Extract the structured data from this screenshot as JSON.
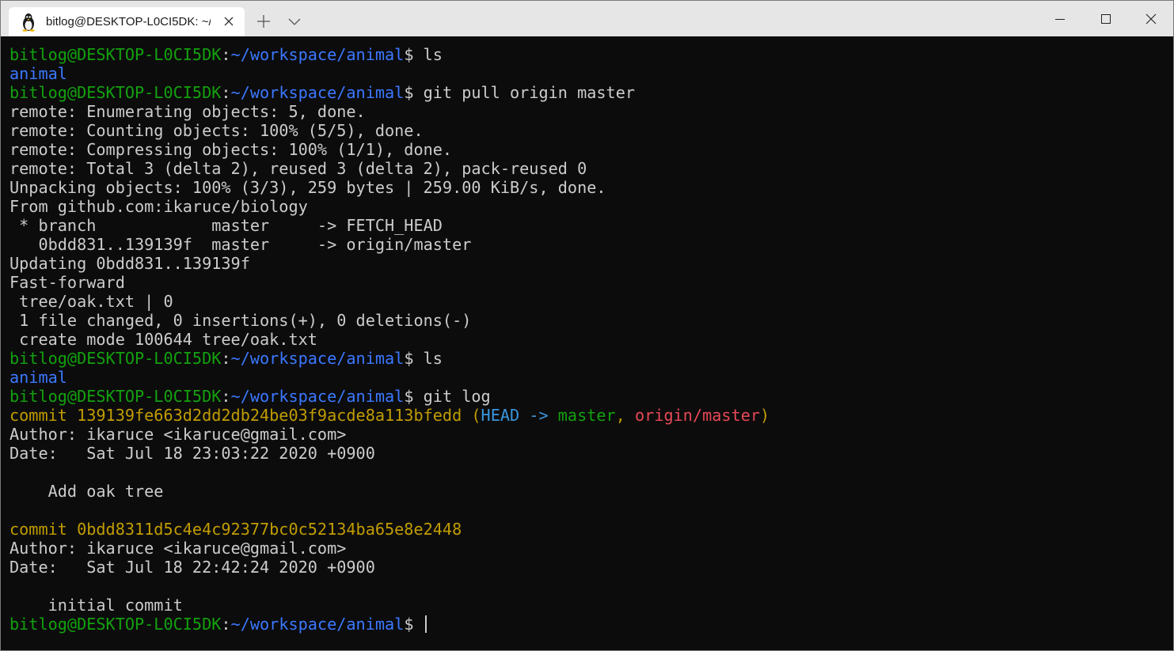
{
  "tab": {
    "title": "bitlog@DESKTOP-L0CI5DK: ~/workspace/animal",
    "icon": "linux-penguin-icon"
  },
  "prompt": {
    "user_host": "bitlog@DESKTOP-L0CI5DK",
    "sep": ":",
    "path": "~/workspace/animal",
    "dollar": "$"
  },
  "colors": {
    "background": "#0c0c0c",
    "green": "#13a10e",
    "blue": "#3b78ff",
    "yellow": "#c19c00",
    "cyan": "#3a96dd",
    "red": "#e74856",
    "text": "#cccccc"
  },
  "lines": [
    {
      "cmd": " ls"
    },
    {
      "dir": "animal"
    },
    {
      "cmd": " git pull origin master"
    },
    {
      "text": "remote: Enumerating objects: 5, done."
    },
    {
      "text": "remote: Counting objects: 100% (5/5), done."
    },
    {
      "text": "remote: Compressing objects: 100% (1/1), done."
    },
    {
      "text": "remote: Total 3 (delta 2), reused 3 (delta 2), pack-reused 0"
    },
    {
      "text": "Unpacking objects: 100% (3/3), 259 bytes | 259.00 KiB/s, done."
    },
    {
      "text": "From github.com:ikaruce/biology"
    },
    {
      "text": " * branch            master     -> FETCH_HEAD"
    },
    {
      "text": "   0bdd831..139139f  master     -> origin/master"
    },
    {
      "text": "Updating 0bdd831..139139f"
    },
    {
      "text": "Fast-forward"
    },
    {
      "text": " tree/oak.txt | 0"
    },
    {
      "text": " 1 file changed, 0 insertions(+), 0 deletions(-)"
    },
    {
      "text": " create mode 100644 tree/oak.txt"
    },
    {
      "cmd": " ls"
    },
    {
      "dir": "animal"
    },
    {
      "cmd": " git log"
    },
    {
      "commit": "commit 139139fe663d2dd2db24be03f9acde8a113bfedd",
      "open": " (",
      "head": "HEAD -> ",
      "branch": "master",
      "comma": ", ",
      "remote": "origin/master",
      "close": ")"
    },
    {
      "text": "Author: ikaruce <ikaruce@gmail.com>"
    },
    {
      "text": "Date:   Sat Jul 18 23:03:22 2020 +0900"
    },
    {
      "text": ""
    },
    {
      "text": "    Add oak tree"
    },
    {
      "text": ""
    },
    {
      "commit": "commit 0bdd8311d5c4e4c92377bc0c52134ba65e8e2448"
    },
    {
      "text": "Author: ikaruce <ikaruce@gmail.com>"
    },
    {
      "text": "Date:   Sat Jul 18 22:42:24 2020 +0900"
    },
    {
      "text": ""
    },
    {
      "text": "    initial commit"
    },
    {
      "cmd": " ",
      "cursor": true
    }
  ]
}
